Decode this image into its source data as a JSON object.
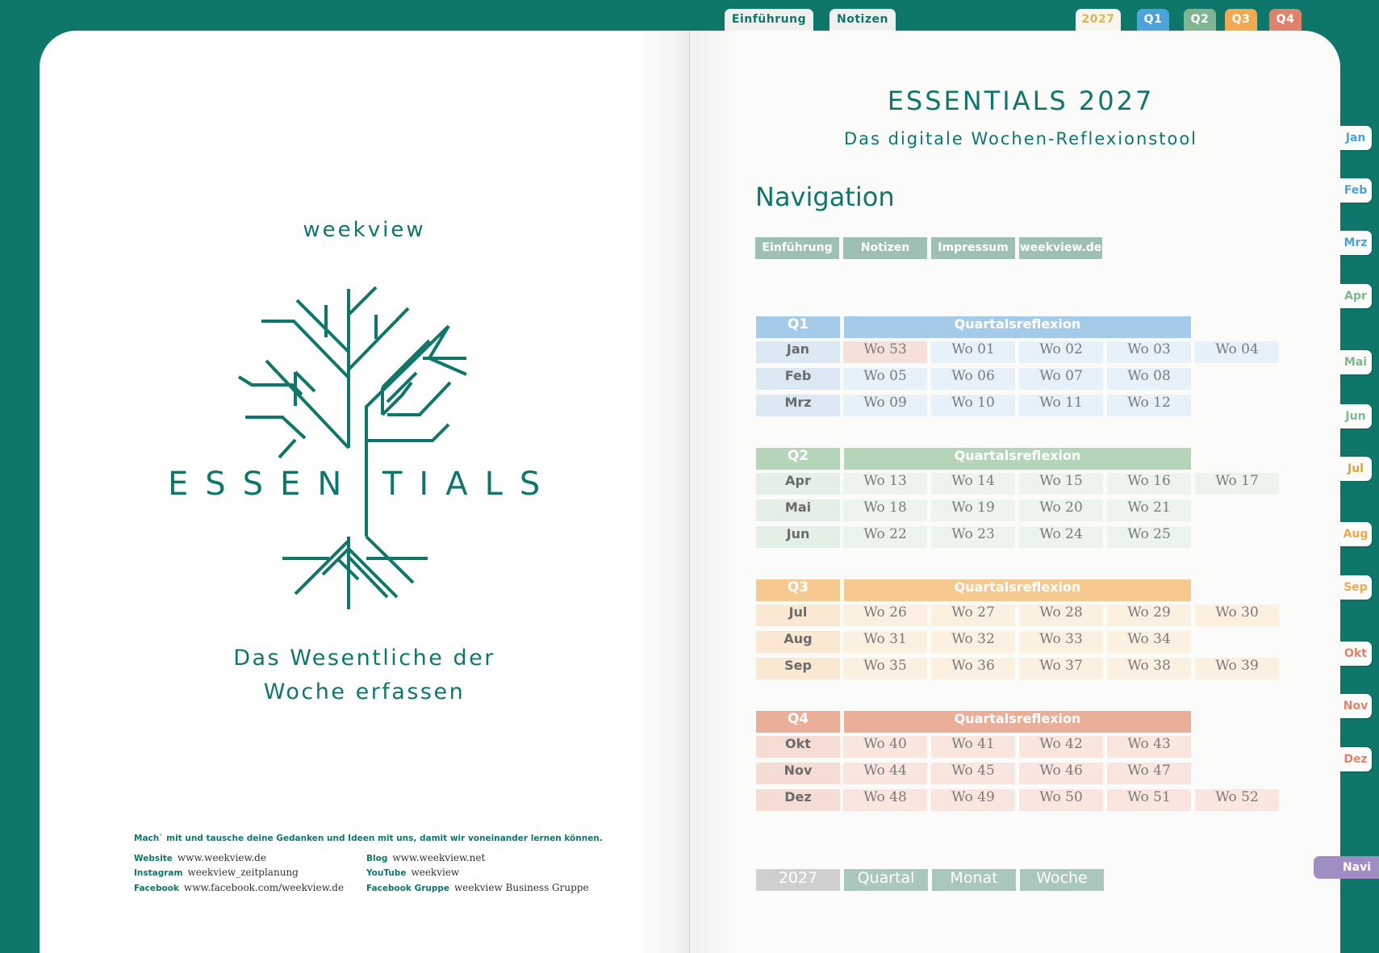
{
  "top_tabs": {
    "intro": "Einführung",
    "notes": "Notizen",
    "year": "2027",
    "q1": "Q1",
    "q2": "Q2",
    "q3": "Q3",
    "q4": "Q4"
  },
  "side_tabs": [
    "Jan",
    "Feb",
    "Mrz",
    "Apr",
    "Mai",
    "Jun",
    "Jul",
    "Aug",
    "Sep",
    "Okt",
    "Nov",
    "Dez"
  ],
  "side_tab_colors": [
    "#4ba3d9",
    "#4ba3d9",
    "#4ba3d9",
    "#7fb591",
    "#7fb591",
    "#7fb591",
    "#e0a23a",
    "#f0a951",
    "#f0a951",
    "#e0826b",
    "#e0826b",
    "#e0826b"
  ],
  "navi_tab": "Navi",
  "left": {
    "brand": "weekview",
    "logo_word_left": "ESSEN",
    "logo_word_right": "TIALS",
    "tagline_line1": "Das Wesentliche der",
    "tagline_line2": "Woche erfassen",
    "invite": "Mach` mit und tausche deine Gedanken und Ideen mit uns, damit wir voneinander lernen können.",
    "website_label": "Website",
    "website": "www.weekview.de",
    "instagram_label": "Instagram",
    "instagram": "weekview_zeitplanung",
    "facebook_label": "Facebook",
    "facebook": "www.facebook.com/weekview.de",
    "blog_label": "Blog",
    "blog": "www.weekview.net",
    "youtube_label": "YouTube",
    "youtube": "weekview",
    "fbgroup_label": "Facebook Gruppe",
    "fbgroup": "weekview Business Gruppe"
  },
  "right": {
    "title": "ESSENTIALS 2027",
    "subtitle": "Das digitale Wochen-Reflexionstool",
    "nav_heading": "Navigation",
    "nav_links": [
      "Einführung",
      "Notizen",
      "Impressum",
      "weekview.de"
    ],
    "reflection_label": "Quartalsreflexion",
    "quarters": [
      {
        "label": "Q1",
        "colors": {
          "head": "#a4cbea",
          "cell": "#e7f1f9",
          "month": "#dce9f4",
          "extra": "#f6e1da"
        },
        "months": [
          {
            "name": "Jan",
            "weeks": [
              "Wo 53",
              "Wo 01",
              "Wo 02",
              "Wo 03",
              "Wo 04"
            ]
          },
          {
            "name": "Feb",
            "weeks": [
              "Wo 05",
              "Wo 06",
              "Wo 07",
              "Wo 08"
            ]
          },
          {
            "name": "Mrz",
            "weeks": [
              "Wo 09",
              "Wo 10",
              "Wo 11",
              "Wo 12"
            ]
          }
        ]
      },
      {
        "label": "Q2",
        "colors": {
          "head": "#b6d4b8",
          "cell": "#edf4ee",
          "month": "#e4efe6",
          "extra": "#edf4ee"
        },
        "months": [
          {
            "name": "Apr",
            "weeks": [
              "Wo 13",
              "Wo 14",
              "Wo 15",
              "Wo 16",
              "Wo 17"
            ]
          },
          {
            "name": "Mai",
            "weeks": [
              "Wo 18",
              "Wo 19",
              "Wo 20",
              "Wo 21"
            ]
          },
          {
            "name": "Jun",
            "weeks": [
              "Wo 22",
              "Wo 23",
              "Wo 24",
              "Wo 25"
            ]
          }
        ]
      },
      {
        "label": "Q3",
        "colors": {
          "head": "#f5c98f",
          "cell": "#fcf0e0",
          "month": "#fae8d2",
          "extra": "#fcf0e0"
        },
        "months": [
          {
            "name": "Jul",
            "weeks": [
              "Wo 26",
              "Wo 27",
              "Wo 28",
              "Wo 29",
              "Wo 30"
            ]
          },
          {
            "name": "Aug",
            "weeks": [
              "Wo 31",
              "Wo 32",
              "Wo 33",
              "Wo 34"
            ]
          },
          {
            "name": "Sep",
            "weeks": [
              "Wo 35",
              "Wo 36",
              "Wo 37",
              "Wo 38",
              "Wo 39"
            ]
          }
        ]
      },
      {
        "label": "Q4",
        "colors": {
          "head": "#ebae98",
          "cell": "#f9e6df",
          "month": "#f6ddd4",
          "extra": "#f9e6df"
        },
        "months": [
          {
            "name": "Okt",
            "weeks": [
              "Wo 40",
              "Wo 41",
              "Wo 42",
              "Wo 43"
            ]
          },
          {
            "name": "Nov",
            "weeks": [
              "Wo 44",
              "Wo 45",
              "Wo 46",
              "Wo 47"
            ]
          },
          {
            "name": "Dez",
            "weeks": [
              "Wo 48",
              "Wo 49",
              "Wo 50",
              "Wo 51",
              "Wo 52"
            ]
          }
        ]
      }
    ],
    "footer_buttons": [
      {
        "label": "2027",
        "color": "#cfcfcd"
      },
      {
        "label": "Quartal",
        "color": "#a9c7bd"
      },
      {
        "label": "Monat",
        "color": "#a9c7bd"
      },
      {
        "label": "Woche",
        "color": "#a9c7bd"
      }
    ]
  }
}
